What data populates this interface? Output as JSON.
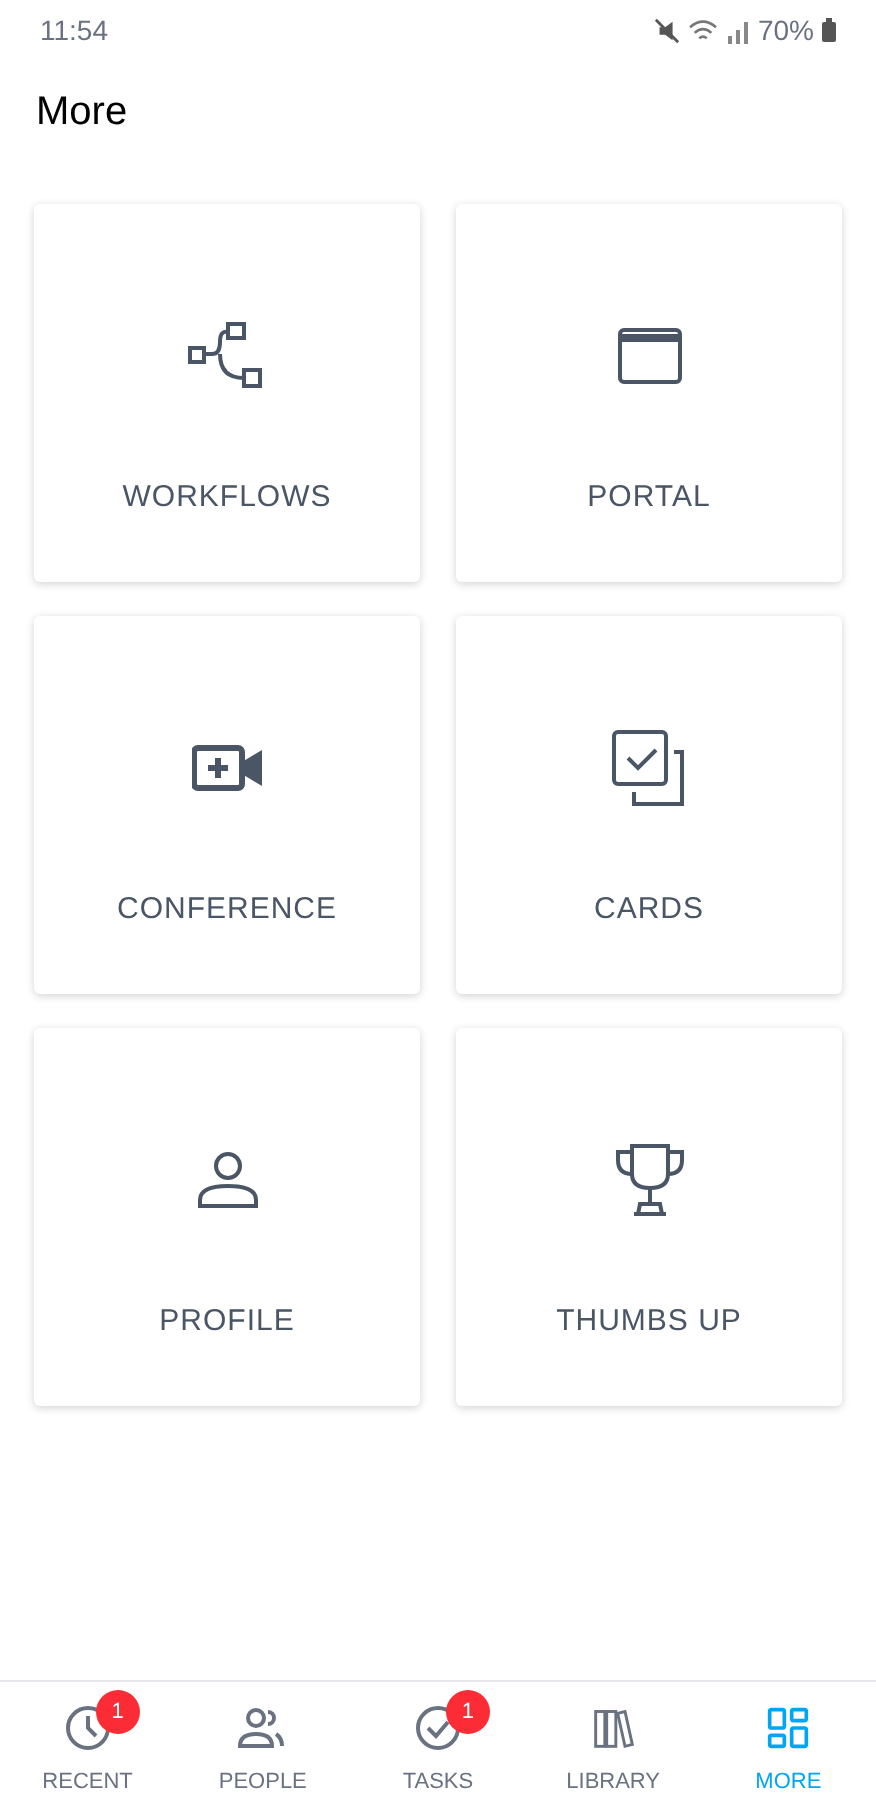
{
  "status_bar": {
    "time": "11:54",
    "battery": "70%"
  },
  "title": "More",
  "tiles": [
    {
      "kind": "workflow",
      "label": "WORKFLOWS"
    },
    {
      "kind": "window",
      "label": "PORTAL"
    },
    {
      "kind": "video",
      "label": "CONFERENCE"
    },
    {
      "kind": "cards",
      "label": "CARDS"
    },
    {
      "kind": "person",
      "label": "PROFILE"
    },
    {
      "kind": "trophy",
      "label": "THUMBS UP"
    }
  ],
  "nav": [
    {
      "kind": "clock",
      "label": "RECENT",
      "badge": "1",
      "selected": false
    },
    {
      "kind": "people",
      "label": "PEOPLE",
      "selected": false
    },
    {
      "kind": "check",
      "label": "TASKS",
      "badge": "1",
      "selected": false
    },
    {
      "kind": "books",
      "label": "LIBRARY",
      "selected": false
    },
    {
      "kind": "grid",
      "label": "MORE",
      "selected": true
    }
  ]
}
